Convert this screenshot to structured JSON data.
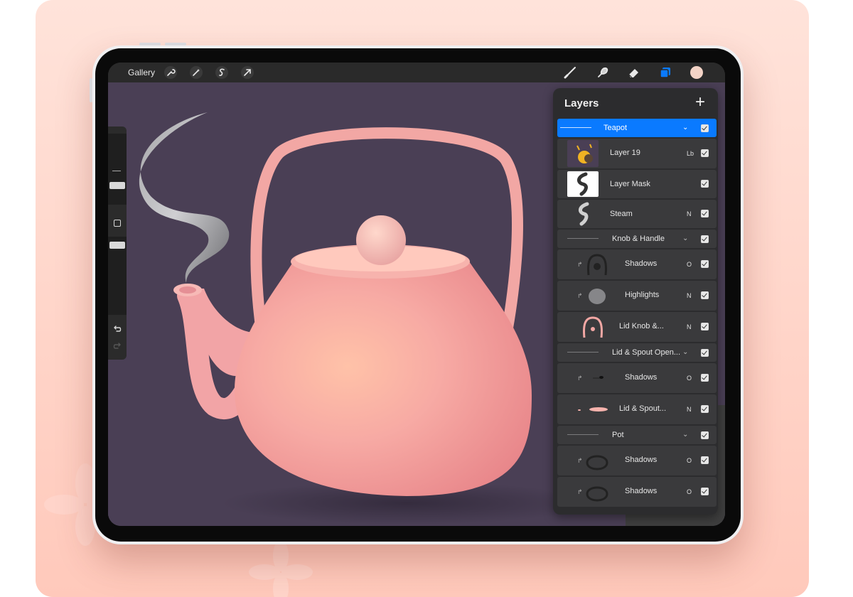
{
  "toolbar": {
    "gallery_label": "Gallery",
    "left_icons": [
      "wrench-icon",
      "magic-wand-icon",
      "selection-s-icon",
      "transform-arrow-icon"
    ],
    "right_icons": [
      "brush-icon",
      "smudge-icon",
      "eraser-icon",
      "layers-icon",
      "color-swatch"
    ],
    "active_color": "#f3d3c6",
    "layers_icon_color": "#0a7aff"
  },
  "layers_panel": {
    "title": "Layers",
    "add_label": "+",
    "rows": [
      {
        "name": "Teapot",
        "type": "group",
        "selected": true
      },
      {
        "name": "Layer 19",
        "mode": "Lb"
      },
      {
        "name": "Layer Mask",
        "mode": ""
      },
      {
        "name": "Steam",
        "mode": "N"
      },
      {
        "name": "Knob & Handle",
        "type": "group"
      },
      {
        "name": "Shadows",
        "mode": "O",
        "clipped": true
      },
      {
        "name": "Highlights",
        "mode": "N",
        "clipped": true
      },
      {
        "name": "Lid Knob &...",
        "mode": "N"
      },
      {
        "name": "Lid & Spout Open...",
        "type": "group"
      },
      {
        "name": "Shadows",
        "mode": "O",
        "clipped": true
      },
      {
        "name": "Lid & Spout...",
        "mode": "N"
      },
      {
        "name": "Pot",
        "type": "group"
      },
      {
        "name": "Shadows",
        "mode": "O",
        "clipped": true
      },
      {
        "name": "Shadows",
        "mode": "O",
        "clipped": true
      }
    ]
  },
  "sidebar": {
    "icons": [
      "brush-size-slider",
      "modify-square-icon",
      "opacity-slider",
      "undo-icon",
      "redo-icon"
    ]
  },
  "colors": {
    "accent": "#0a7aff",
    "canvas": "#4a3f55",
    "teapot": "#f4a3a0"
  }
}
